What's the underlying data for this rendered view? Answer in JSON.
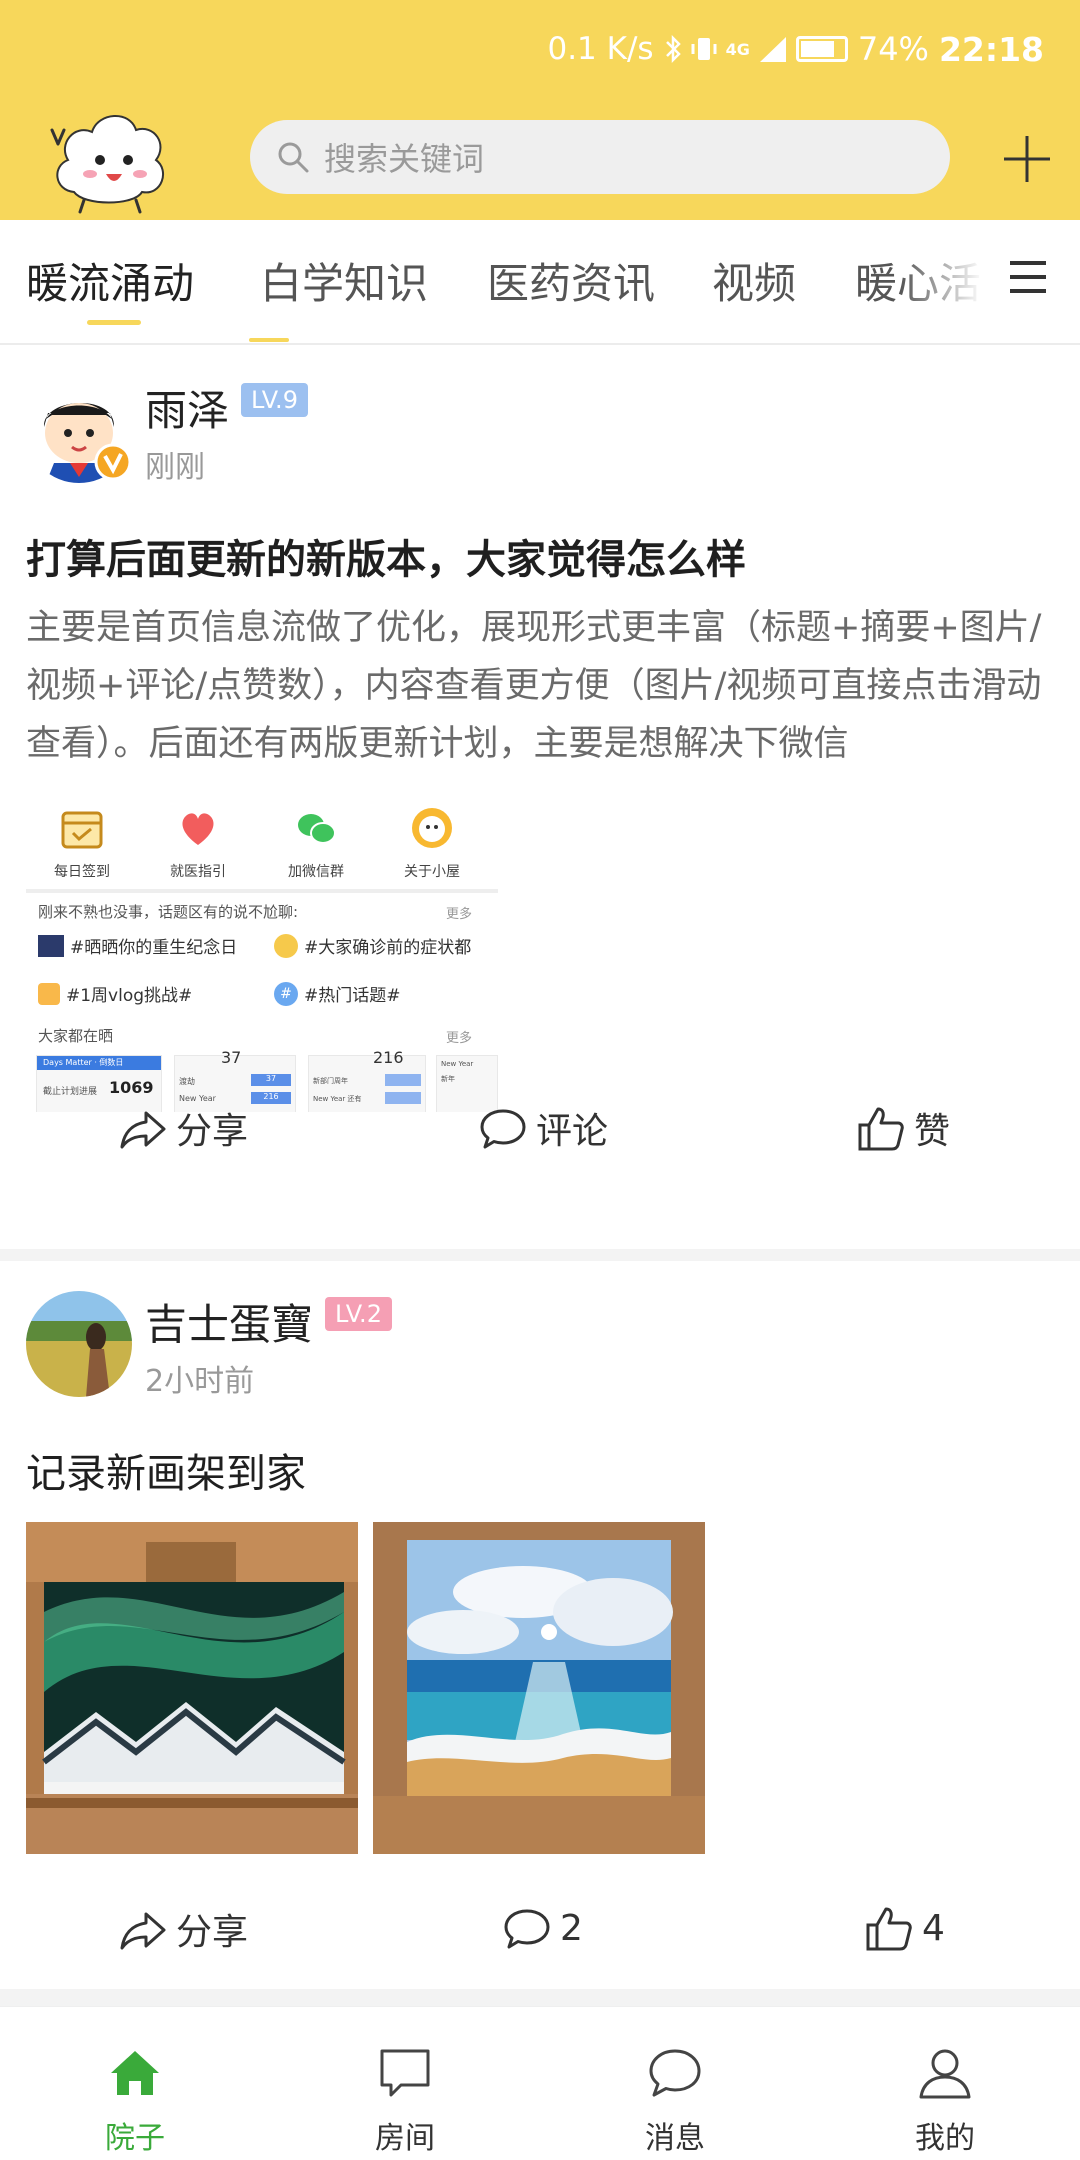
{
  "status_bar": {
    "speed": "0.1 K/s",
    "network": "4G",
    "battery": "74%",
    "battery_level": 0.74,
    "time": "22:18"
  },
  "header": {
    "search_placeholder": "搜索关键词",
    "mascot_icon": "cloud-mascot-icon",
    "add_icon": "plus-icon"
  },
  "tabs": [
    {
      "label": "暖流涌动",
      "active": true
    },
    {
      "label": "白学知识",
      "active": false
    },
    {
      "label": "医药资讯",
      "active": false
    },
    {
      "label": "视频",
      "active": false
    },
    {
      "label": "暖心活",
      "active": false
    }
  ],
  "posts": [
    {
      "user": "雨泽",
      "level": "LV.9",
      "level_color": "#9cc0f0",
      "verified": true,
      "time": "刚刚",
      "title": "打算后面更新的新版本，大家觉得怎么样",
      "body": "主要是首页信息流做了优化，展现形式更丰富（标题+摘要+图片/视频+评论/点赞数），内容查看更方便（图片/视频可直接点击滑动查看）。后面还有两版更新计划，主要是想解决下微信",
      "preview": {
        "icons": [
          "每日签到",
          "就医指引",
          "加微信群",
          "关于小屋"
        ],
        "topics_header": "刚来不熟也没事，话题区有的说不尬聊:",
        "more": "更多",
        "topics": [
          "#晒晒你的重生纪念日",
          "#大家确诊前的症状都",
          "#1周vlog挑战#",
          "#热门话题#"
        ],
        "sharing_header": "大家都在晒",
        "card_app": "Days Matter · 倒数日",
        "card_text": "截止计划进展",
        "card_number": "1069",
        "numbers": [
          "37",
          "216",
          "216"
        ],
        "rows": [
          "渡劫",
          "New Year",
          "新年",
          "新部门周年",
          "New Year 还有"
        ]
      },
      "actions": {
        "share": "分享",
        "comment": "评论",
        "like": "赞"
      }
    },
    {
      "user": "吉士蛋寶",
      "level": "LV.2",
      "level_color": "#f59fb4",
      "time": "2小时前",
      "title": "记录新画架到家",
      "actions": {
        "share": "分享",
        "comment": "2",
        "like": "4"
      }
    }
  ],
  "bottom_nav": [
    {
      "label": "院子",
      "icon": "house-icon",
      "active": true
    },
    {
      "label": "房间",
      "icon": "message-square-icon",
      "active": false
    },
    {
      "label": "消息",
      "icon": "chat-bubble-icon",
      "active": false
    },
    {
      "label": "我的",
      "icon": "user-icon",
      "active": false
    }
  ],
  "colors": {
    "brand_yellow": "#f7d75b",
    "active_green": "#3aaa3a"
  }
}
